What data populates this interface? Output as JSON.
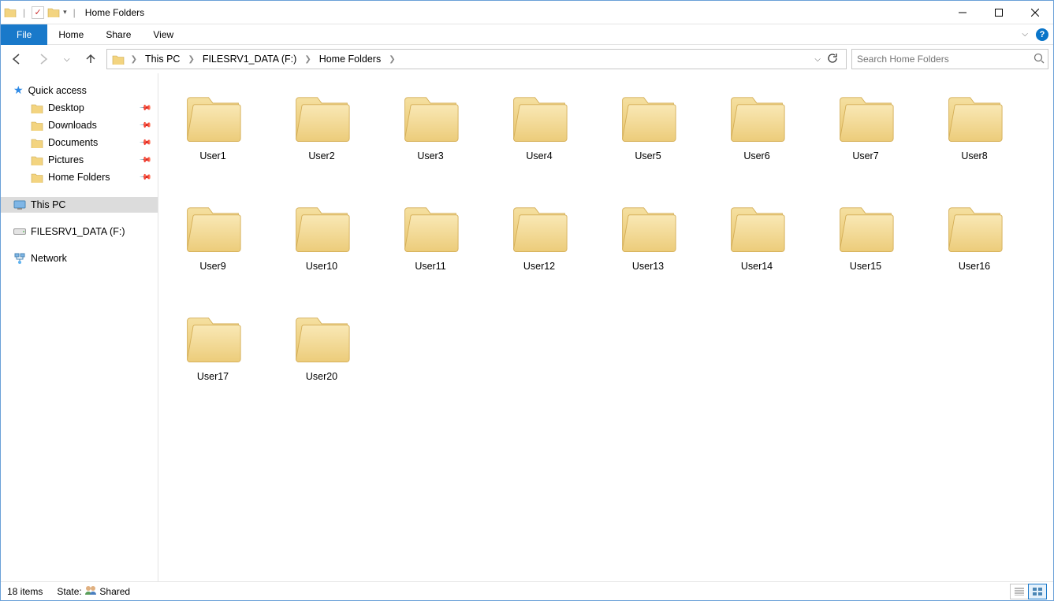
{
  "window": {
    "title": "Home Folders"
  },
  "menubar": {
    "file": "File",
    "home": "Home",
    "share": "Share",
    "view": "View"
  },
  "breadcrumbs": {
    "items": [
      {
        "label": "This PC"
      },
      {
        "label": "FILESRV1_DATA (F:)"
      },
      {
        "label": "Home Folders"
      }
    ]
  },
  "search": {
    "placeholder": "Search Home Folders"
  },
  "sidebar": {
    "quick_access": "Quick access",
    "quick": [
      {
        "label": "Desktop",
        "pinned": true
      },
      {
        "label": "Downloads",
        "pinned": true
      },
      {
        "label": "Documents",
        "pinned": true
      },
      {
        "label": "Pictures",
        "pinned": true
      },
      {
        "label": "Home Folders",
        "pinned": true
      }
    ],
    "this_pc": "This PC",
    "drive": "FILESRV1_DATA (F:)",
    "network": "Network"
  },
  "folders": [
    "User1",
    "User2",
    "User3",
    "User4",
    "User5",
    "User6",
    "User7",
    "User8",
    "User9",
    "User10",
    "User11",
    "User12",
    "User13",
    "User14",
    "User15",
    "User16",
    "User17",
    "User20"
  ],
  "status": {
    "count": "18 items",
    "state_label": "State:",
    "state_value": "Shared"
  }
}
